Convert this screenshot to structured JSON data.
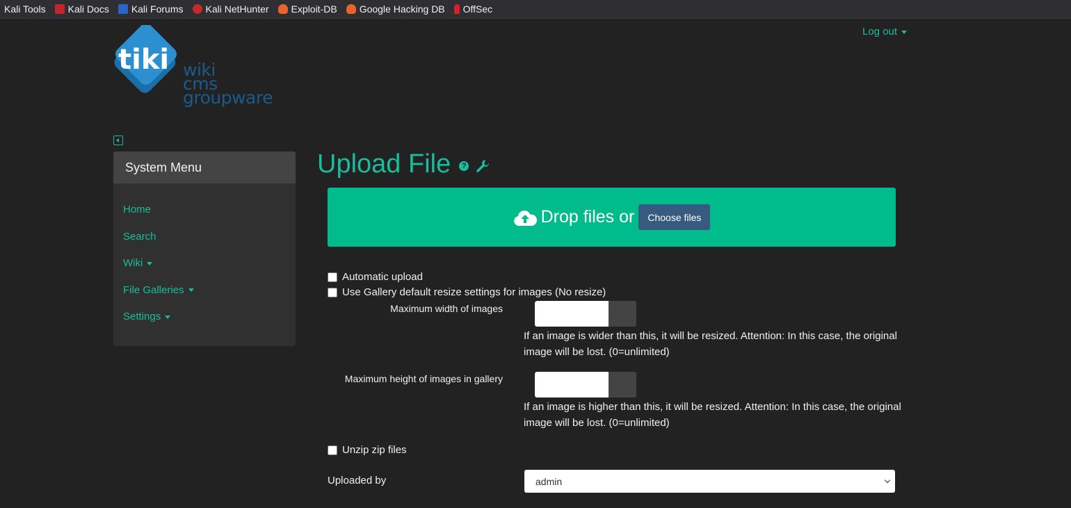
{
  "bookmarks": [
    {
      "label": "Kali Tools",
      "icon": "kali-dragon-icon"
    },
    {
      "label": "Kali Docs",
      "icon": "kali-docs-icon"
    },
    {
      "label": "Kali Forums",
      "icon": "kali-forums-icon"
    },
    {
      "label": "Kali NetHunter",
      "icon": "nethunter-icon"
    },
    {
      "label": "Exploit-DB",
      "icon": "exploitdb-icon"
    },
    {
      "label": "Google Hacking DB",
      "icon": "ghdb-icon"
    },
    {
      "label": "OffSec",
      "icon": "offsec-icon"
    }
  ],
  "logo": {
    "word": "tiki",
    "lines": [
      "wiki",
      "cms",
      "groupware"
    ]
  },
  "header": {
    "logout_label": "Log out"
  },
  "sidebar": {
    "title": "System Menu",
    "items": [
      {
        "label": "Home"
      },
      {
        "label": "Search"
      },
      {
        "label": "Wiki"
      },
      {
        "label": "File Galleries"
      },
      {
        "label": "Settings"
      }
    ]
  },
  "main": {
    "title": "Upload File",
    "dropzone": {
      "text": "Drop files or",
      "button": "Choose files"
    },
    "auto_upload_label": "Automatic upload",
    "resize_label": "Use Gallery default resize settings for images (No resize)",
    "max_width_label": "Maximum width of images",
    "max_width_help": "If an image is wider than this, it will be resized. Attention: In this case, the original image will be lost. (0=unlimited)",
    "max_height_label": "Maximum height of images in gallery",
    "max_height_help": "If an image is higher than this, it will be resized. Attention: In this case, the original image will be lost. (0=unlimited)",
    "unzip_label": "Unzip zip files",
    "uploaded_by_label": "Uploaded by",
    "uploaded_by_value": "admin"
  },
  "colors": {
    "accent": "#1bbc9b",
    "dropzone": "#00bc8c",
    "button": "#375a7f",
    "background": "#222222"
  }
}
